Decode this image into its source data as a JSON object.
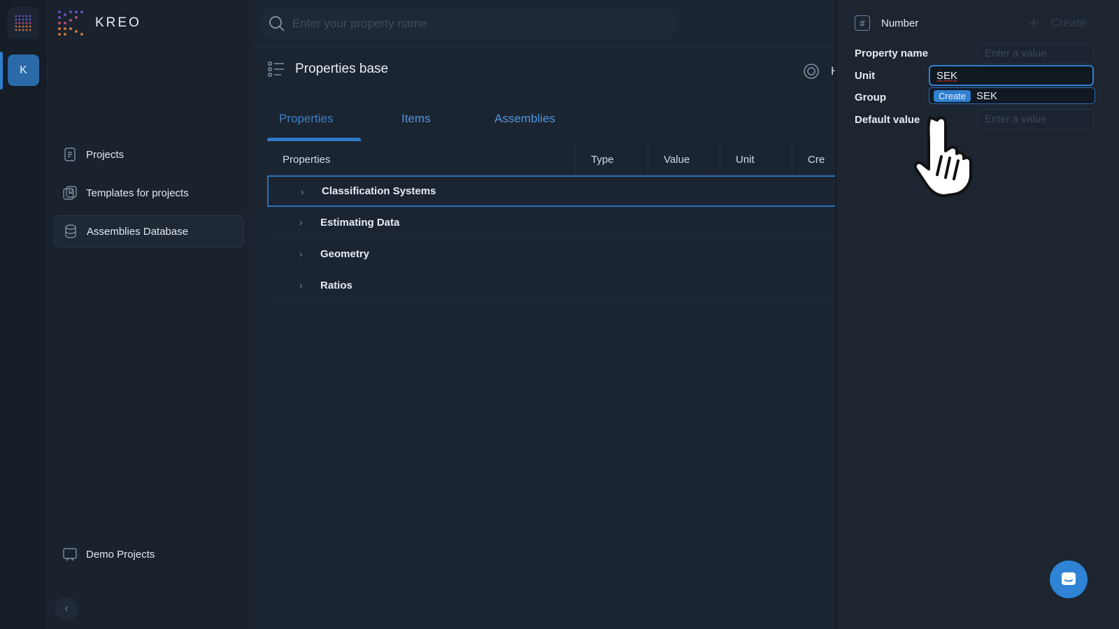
{
  "brand": {
    "name": "KREO"
  },
  "rail": {
    "avatar_initial": "K"
  },
  "sidebar": {
    "items": [
      {
        "label": "Projects"
      },
      {
        "label": "Templates for projects"
      },
      {
        "label": "Assemblies Database"
      },
      {
        "label": "Demo Projects"
      }
    ]
  },
  "search": {
    "placeholder": "Enter your property name"
  },
  "page": {
    "title": "Properties base",
    "help_letter": "H"
  },
  "tabs": [
    {
      "label": "Properties"
    },
    {
      "label": "Items"
    },
    {
      "label": "Assemblies"
    }
  ],
  "table": {
    "headers": [
      "Properties",
      "Type",
      "Value",
      "Unit",
      "Cre"
    ],
    "rows": [
      {
        "label": "Classification Systems"
      },
      {
        "label": "Estimating Data"
      },
      {
        "label": "Geometry"
      },
      {
        "label": "Ratios"
      }
    ]
  },
  "panel": {
    "type_label": "Number",
    "create_label": "Create",
    "fields": {
      "property_name_label": "Property name",
      "property_name_placeholder": "Enter a value",
      "unit_label": "Unit",
      "unit_value": "SEK",
      "group_label": "Group",
      "default_value_label": "Default value",
      "default_value_placeholder": "Enter a value"
    },
    "dropdown": {
      "badge": "Create",
      "value": "SEK"
    }
  },
  "colors": {
    "accent": "#2f7fd0",
    "background": "#1b2531",
    "panel": "#1c2530"
  }
}
